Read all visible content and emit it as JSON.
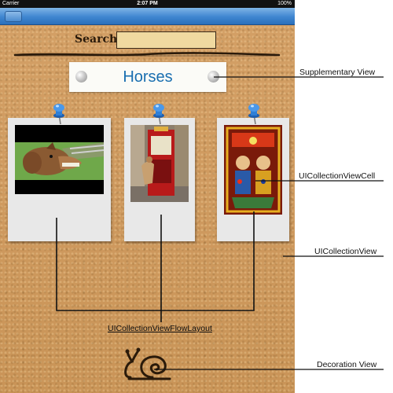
{
  "status_bar": {
    "carrier": "Carrier",
    "time": "2:07 PM",
    "battery": "100%"
  },
  "search": {
    "label": "Search:",
    "value": ""
  },
  "header": {
    "title": "Horses"
  },
  "cells": [
    {
      "subject": "horse-photo"
    },
    {
      "subject": "red-booth-horse-photo"
    },
    {
      "subject": "carousel-art-photo"
    }
  ],
  "callouts": {
    "supplementary": "Supplementary View",
    "cell": "UICollectionViewCell",
    "collection_view": "UICollectionView",
    "layout": "UICollectionViewFlowLayout",
    "decoration": "Decoration View"
  },
  "colors": {
    "cork": "#cf9a5f",
    "nav_blue": "#3f86d0",
    "title_blue": "#1a6fb0",
    "pin_blue": "#2f7fd6"
  }
}
